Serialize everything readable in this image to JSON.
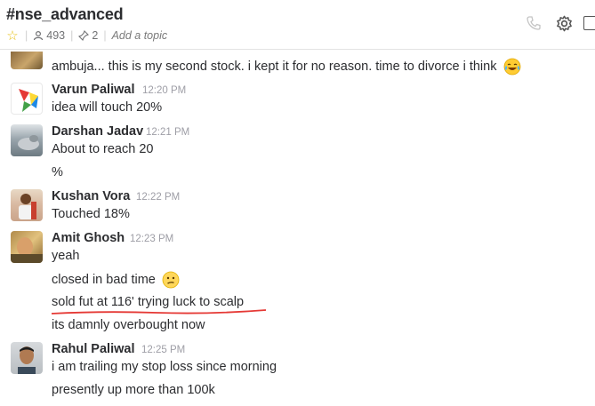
{
  "channel": {
    "name": "#nse_advanced",
    "members": "493",
    "pinned": "2",
    "add_topic": "Add a topic"
  },
  "colors": {
    "star": "#e8c21a",
    "underline": "#e53935",
    "timestamp": "#9e9ea6"
  },
  "icons": [
    "star-icon",
    "members-icon",
    "pin-icon",
    "call-icon",
    "gear-icon",
    "side-panel-icon",
    "tears-of-joy-emoji",
    "confused-face-emoji"
  ],
  "messages": [
    {
      "text": "ambuja... this is my second stock. i kept it for no reason. time to divorce i think"
    },
    {
      "author": "Varun Paliwal",
      "time": "12:20 PM",
      "lines": [
        "idea will touch 20%"
      ]
    },
    {
      "author": "Darshan Jadav",
      "time": "12:21 PM",
      "lines": [
        "About to reach 20",
        "%"
      ]
    },
    {
      "author": "Kushan Vora",
      "time": "12:22 PM",
      "lines": [
        "Touched 18%"
      ]
    },
    {
      "author": "Amit Ghosh",
      "time": "12:23 PM",
      "lines": [
        "yeah",
        "closed in bad time",
        "sold fut at 116' trying luck to scalp",
        "its damnly overbought now"
      ]
    },
    {
      "author": "Rahul Paliwal",
      "time": "12:25 PM",
      "lines": [
        "i am trailing my stop loss since morning",
        "presently up more than 100k"
      ]
    }
  ]
}
